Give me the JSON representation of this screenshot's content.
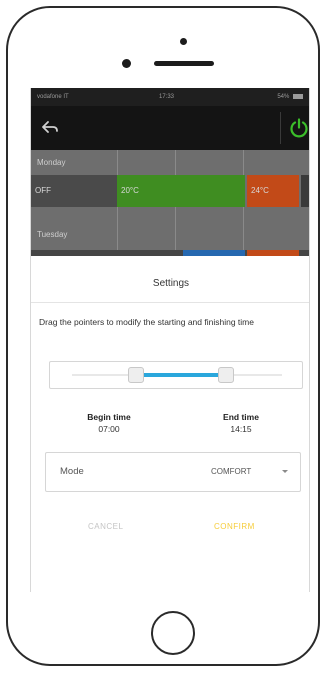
{
  "status_bar": {
    "carrier": "vodafone IT",
    "time": "17:33",
    "battery": "54%"
  },
  "header": {
    "back_icon": "back-arrow-icon",
    "power_icon": "power-icon"
  },
  "schedule": {
    "days": [
      {
        "label": "Monday",
        "segments": [
          {
            "label": "OFF",
            "color": "#4a4a4a"
          },
          {
            "label": "20°C",
            "color": "#3f8d21"
          },
          {
            "label": "24°C",
            "color": "#c24a18"
          }
        ]
      },
      {
        "label": "Tuesday",
        "segments": []
      }
    ]
  },
  "dialog": {
    "title": "Settings",
    "instructions": "Drag the pointers to modify the starting and finishing time",
    "slider": {
      "range_start_fraction": 0.34,
      "range_end_fraction": 0.74
    },
    "begin_time_label": "Begin time",
    "begin_time_value": "07:00",
    "end_time_label": "End time",
    "end_time_value": "14:15",
    "mode_label": "Mode",
    "mode_value": "COMFORT",
    "cancel_label": "CANCEL",
    "confirm_label": "CONFIRM"
  },
  "colors": {
    "accent_blue": "#2aa7dc",
    "confirm_yellow": "#f6cd3a",
    "power_green": "#3bbd2a"
  }
}
